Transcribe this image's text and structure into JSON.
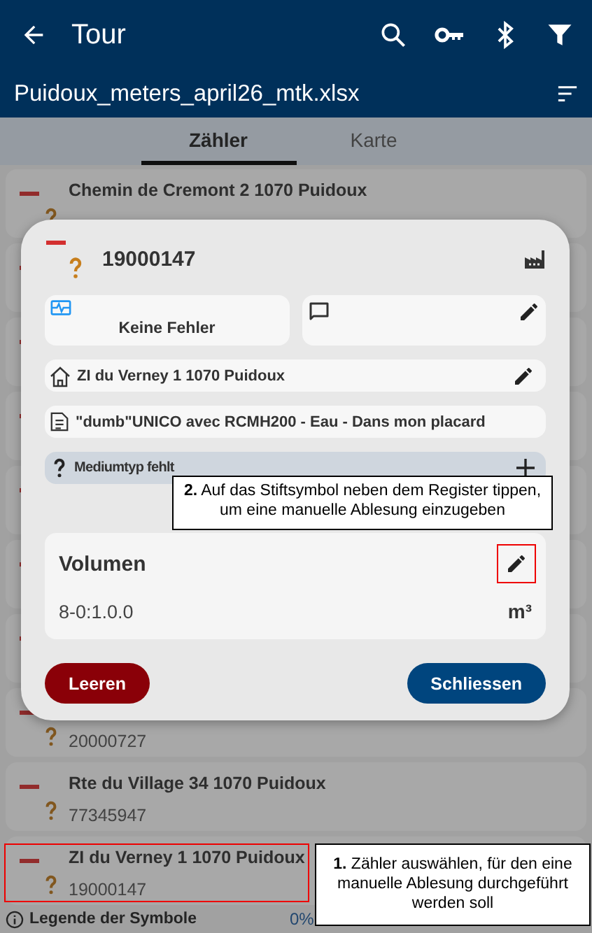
{
  "app_bar": {
    "title": "Tour",
    "subtitle": "Puidoux_meters_april26_mtk.xlsx"
  },
  "tabs": [
    {
      "label": "Zähler",
      "selected": true
    },
    {
      "label": "Karte",
      "selected": false
    }
  ],
  "meters": [
    {
      "kind": "meter",
      "name": "Chemin de Cremont 2 1070 Puidoux"
    },
    {
      "kind": "covered"
    },
    {
      "kind": "covered"
    },
    {
      "kind": "covered"
    },
    {
      "kind": "covered"
    },
    {
      "kind": "covered"
    },
    {
      "kind": "covered"
    },
    {
      "kind": "meter",
      "number": "20000727"
    },
    {
      "kind": "meter",
      "name": "Rte du Village 34 1070 Puidoux",
      "number": "77345947"
    },
    {
      "kind": "meter",
      "name": "ZI du Verney 1 1070 Puidoux",
      "number": "19000147"
    }
  ],
  "footer": {
    "legend": "Legende der Symbole",
    "percent": "0%"
  },
  "dialog": {
    "meter_number": "19000147",
    "status": "Keine Fehler",
    "address": "ZI du Verney 1 1070 Puidoux",
    "description": "\"dumb\"UNICO avec RCMH200 - Eau - Dans mon placard",
    "warning": "Mediumtyp fehlt",
    "register": {
      "name": "Volumen",
      "obis": "8-0:1.0.0",
      "unit": "m³"
    },
    "buttons": [
      {
        "label": "Leeren",
        "kind": "danger"
      },
      {
        "label": "Schliessen",
        "kind": "primary"
      }
    ]
  },
  "callouts": [
    {
      "step": "2.",
      "text": "Auf das Stiftsymbol neben dem Register tippen, um eine manuelle Ablesung einzugeben"
    },
    {
      "step": "1.",
      "text": "Zähler auswählen, für den eine manuelle Ablesung durchgeführt werden soll"
    }
  ]
}
